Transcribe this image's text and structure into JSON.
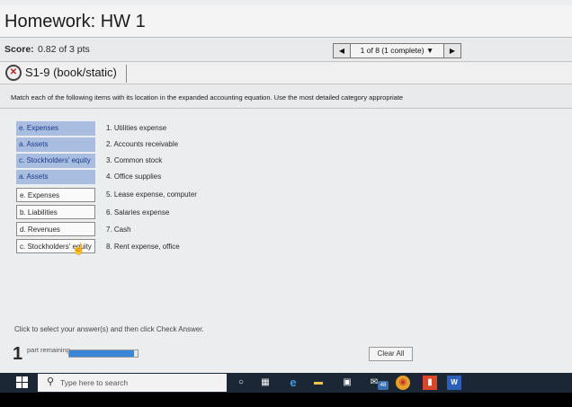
{
  "header": {
    "title": "Homework: HW 1"
  },
  "score": {
    "label": "Score:",
    "value": "0.82 of 3 pts"
  },
  "navigation": {
    "prev_icon": "◀",
    "next_icon": "▶",
    "progress_label": "1 of 8 (1 complete) ▼"
  },
  "question": {
    "icon": "✕",
    "id": "S1-9 (book/static)"
  },
  "instructions": "Match each of the following items with its location in the expanded accounting equation. Use the most detailed category appropriate",
  "answers": [
    "e. Expenses",
    "a. Assets",
    "c. Stockholders' equity",
    "a. Assets",
    "e. Expenses",
    "b. Liabilities",
    "d. Revenues",
    "c. Stockholders' equity"
  ],
  "items": [
    "1. Utilities expense",
    "2. Accounts receivable",
    "3. Common stock",
    "4. Office supplies",
    "5. Lease expense, computer",
    "6. Salaries expense",
    "7. Cash",
    "8. Rent expense, office"
  ],
  "prompt": "Click to select your answer(s) and then click Check Answer.",
  "parts": {
    "count": "1",
    "label": "part remaining",
    "progress_fraction": 0.95
  },
  "clear_button": "Clear All",
  "taskbar": {
    "search_placeholder": "Type here to search",
    "mail_badge": "48",
    "icons": [
      "windows-start-icon",
      "search-icon",
      "task-view-icon",
      "file-explorer-grid-icon",
      "edge-icon",
      "file-manager-icon",
      "store-icon",
      "mail-icon",
      "chrome-icon",
      "office-icon",
      "word-icon"
    ]
  }
}
